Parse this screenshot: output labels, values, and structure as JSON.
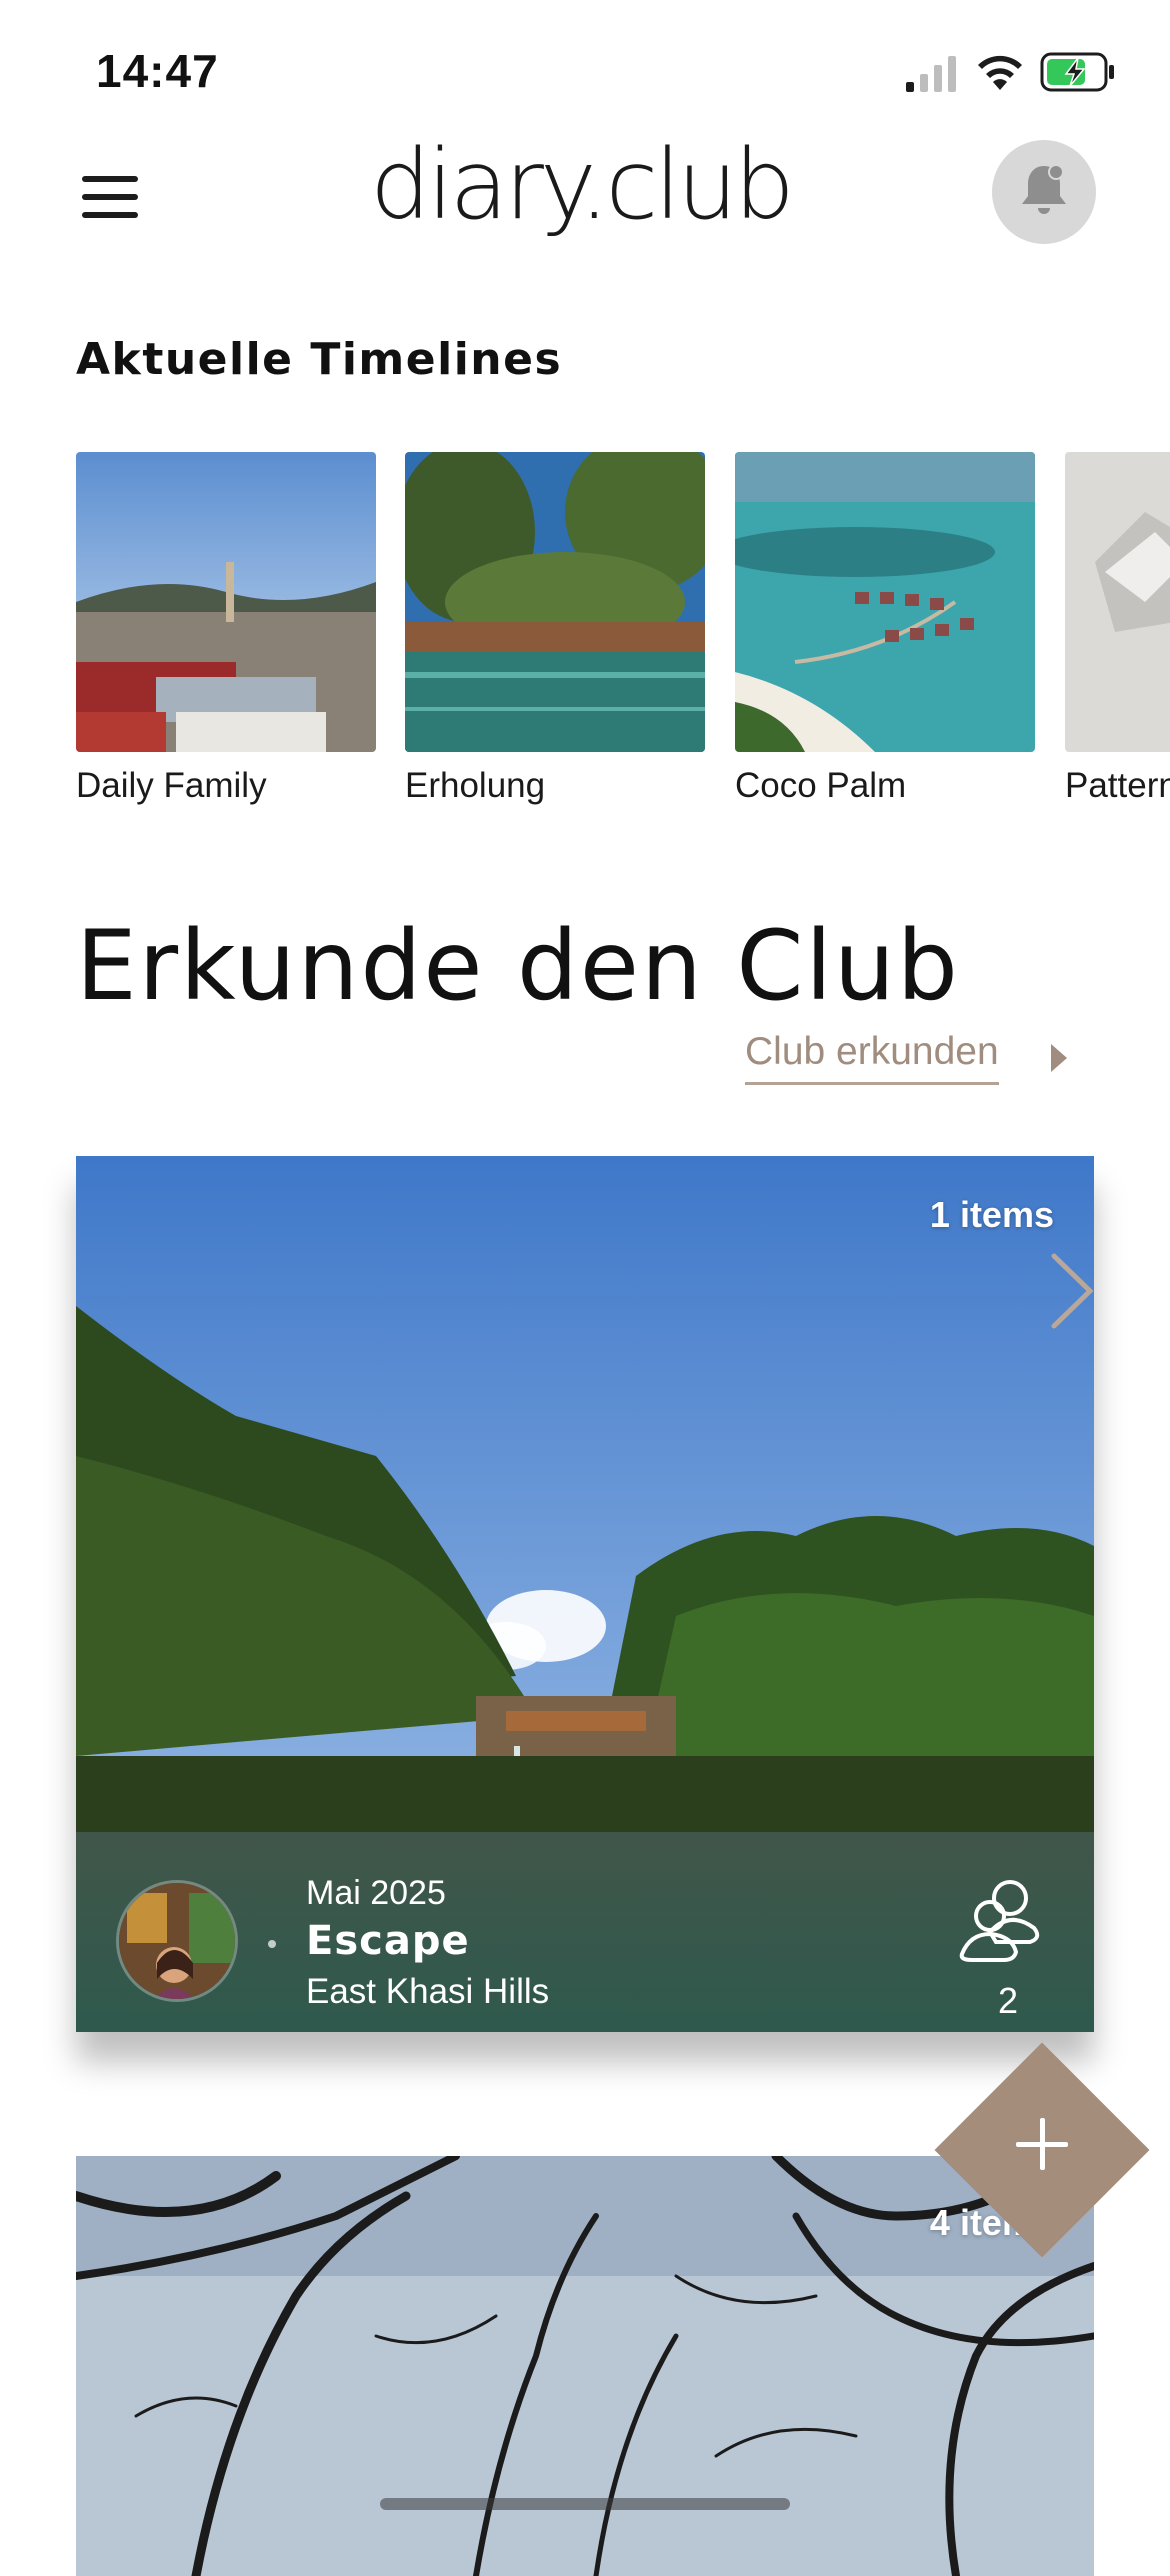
{
  "status_bar": {
    "time": "14:47",
    "icons": [
      "signal-icon",
      "wifi-icon",
      "battery-charging-icon"
    ]
  },
  "header": {
    "logo": "diary.club",
    "menu_icon": "hamburger-menu-icon",
    "notification_icon": "bell-icon"
  },
  "timelines": {
    "title": "Aktuelle Timelines",
    "items": [
      {
        "label": "Daily Family"
      },
      {
        "label": "Erholung"
      },
      {
        "label": "Coco Palm"
      },
      {
        "label": "Pattern"
      }
    ]
  },
  "explore": {
    "title": "Erkunde den Club",
    "link_label": "Club erkunden"
  },
  "cards": [
    {
      "items_label": "1 items",
      "date": "Mai 2025",
      "name": "Escape",
      "location": "East Khasi Hills",
      "members": "2"
    },
    {
      "items_label": "4 items"
    }
  ],
  "fab": {
    "icon": "plus-icon"
  },
  "colors": {
    "accent": "#a58d7c",
    "link": "#a08d7f"
  }
}
